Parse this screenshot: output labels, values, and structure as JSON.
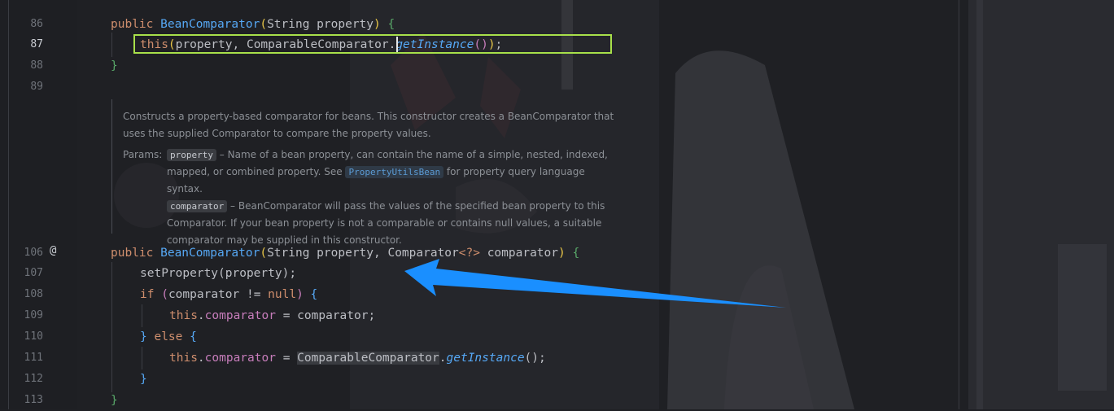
{
  "editor": {
    "line_numbers": [
      "86",
      "87",
      "88",
      "89",
      "106",
      "107",
      "108",
      "109",
      "110",
      "111",
      "112",
      "113"
    ],
    "gutter_marker": "@",
    "code": {
      "l86": {
        "public": "public ",
        "name": "BeanComparator",
        "open": "(",
        "params": "String property",
        "close": ")",
        "brace": " {"
      },
      "l87": {
        "this": "this",
        "open": "(",
        "args": "property, ",
        "cls": "ComparableComparator",
        "dot": ".",
        "method": "getInstance",
        "call": "()",
        "close": ")",
        "semi": ";"
      },
      "l88": {
        "brace": "}"
      },
      "l106": {
        "public": "public ",
        "name": "BeanComparator",
        "open": "(",
        "params": "String property, Comparator",
        "generic": "<?>",
        "rest": " comparator",
        "close": ")",
        "brace": " {"
      },
      "l107": {
        "text": "setProperty(property);"
      },
      "l108": {
        "if": "if ",
        "open": "(",
        "cond": "comparator != ",
        "null": "null",
        "close": ")",
        "brace": " {"
      },
      "l109": {
        "this": "this",
        "dot": ".",
        "field": "comparator",
        "rest": " = comparator;"
      },
      "l110": {
        "close": "} ",
        "else": "else",
        "brace": " {"
      },
      "l111": {
        "this": "this",
        "dot": ".",
        "field": "comparator",
        "eq": " = ",
        "cls": "ComparableComparator",
        "dot2": ".",
        "method": "getInstance",
        "rest": "();"
      },
      "l112": {
        "brace": "}"
      },
      "l113": {
        "brace": "}"
      }
    },
    "doc": {
      "description": "Constructs a property-based comparator for beans. This constructor creates a BeanComparator that uses the supplied Comparator to compare the property values.",
      "params_label": "Params:",
      "p1_tag": "property",
      "p1_text_a": " – Name of a bean property, can contain the name of a simple, nested, indexed, mapped, or combined property. See ",
      "p1_link": "PropertyUtilsBean",
      "p1_text_b": " for property query language syntax.",
      "p2_tag": "comparator",
      "p2_text": " – BeanComparator will pass the values of the specified bean property to this Comparator. If your bean property is not a comparable or contains null values, a suitable comparator may be supplied in this constructor."
    }
  },
  "colors": {
    "highlight_box": "#a8e04a",
    "arrow": "#1a8fff",
    "keyword": "#cf8e6d",
    "function": "#56a8f5"
  }
}
